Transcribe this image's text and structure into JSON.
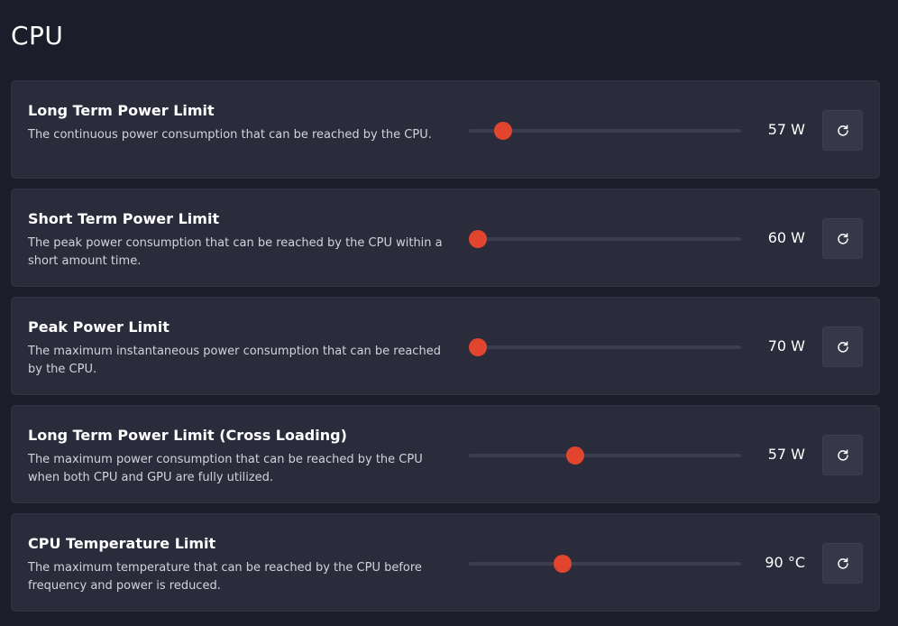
{
  "page": {
    "title": "CPU"
  },
  "colors": {
    "background": "#1b1d2a",
    "card": "#2a2c3b",
    "slider_track": "#3d3f4f",
    "slider_thumb": "#e2452d",
    "reset_button": "#363847"
  },
  "settings": [
    {
      "title": "Long Term Power Limit",
      "description": "The continuous power consumption that can be reached by the CPU.",
      "value": "57 W",
      "slider_fraction": 0.125,
      "reset_icon": "reset-icon"
    },
    {
      "title": "Short Term Power Limit",
      "description": "The peak power consumption that can be reached by the CPU within a short amount time.",
      "value": "60 W",
      "slider_fraction": 0.033,
      "reset_icon": "reset-icon"
    },
    {
      "title": "Peak Power Limit",
      "description": "The maximum instantaneous power consumption that can be reached by the CPU.",
      "value": "70 W",
      "slider_fraction": 0.033,
      "reset_icon": "reset-icon"
    },
    {
      "title": "Long Term Power Limit (Cross Loading)",
      "description": "The maximum power consumption that can be reached by the CPU when both CPU and GPU are fully utilized.",
      "value": "57 W",
      "slider_fraction": 0.39,
      "reset_icon": "reset-icon"
    },
    {
      "title": "CPU Temperature Limit",
      "description": "The maximum temperature that can be reached by the CPU before frequency and power is reduced.",
      "value": "90 °C",
      "slider_fraction": 0.345,
      "reset_icon": "reset-icon"
    }
  ]
}
